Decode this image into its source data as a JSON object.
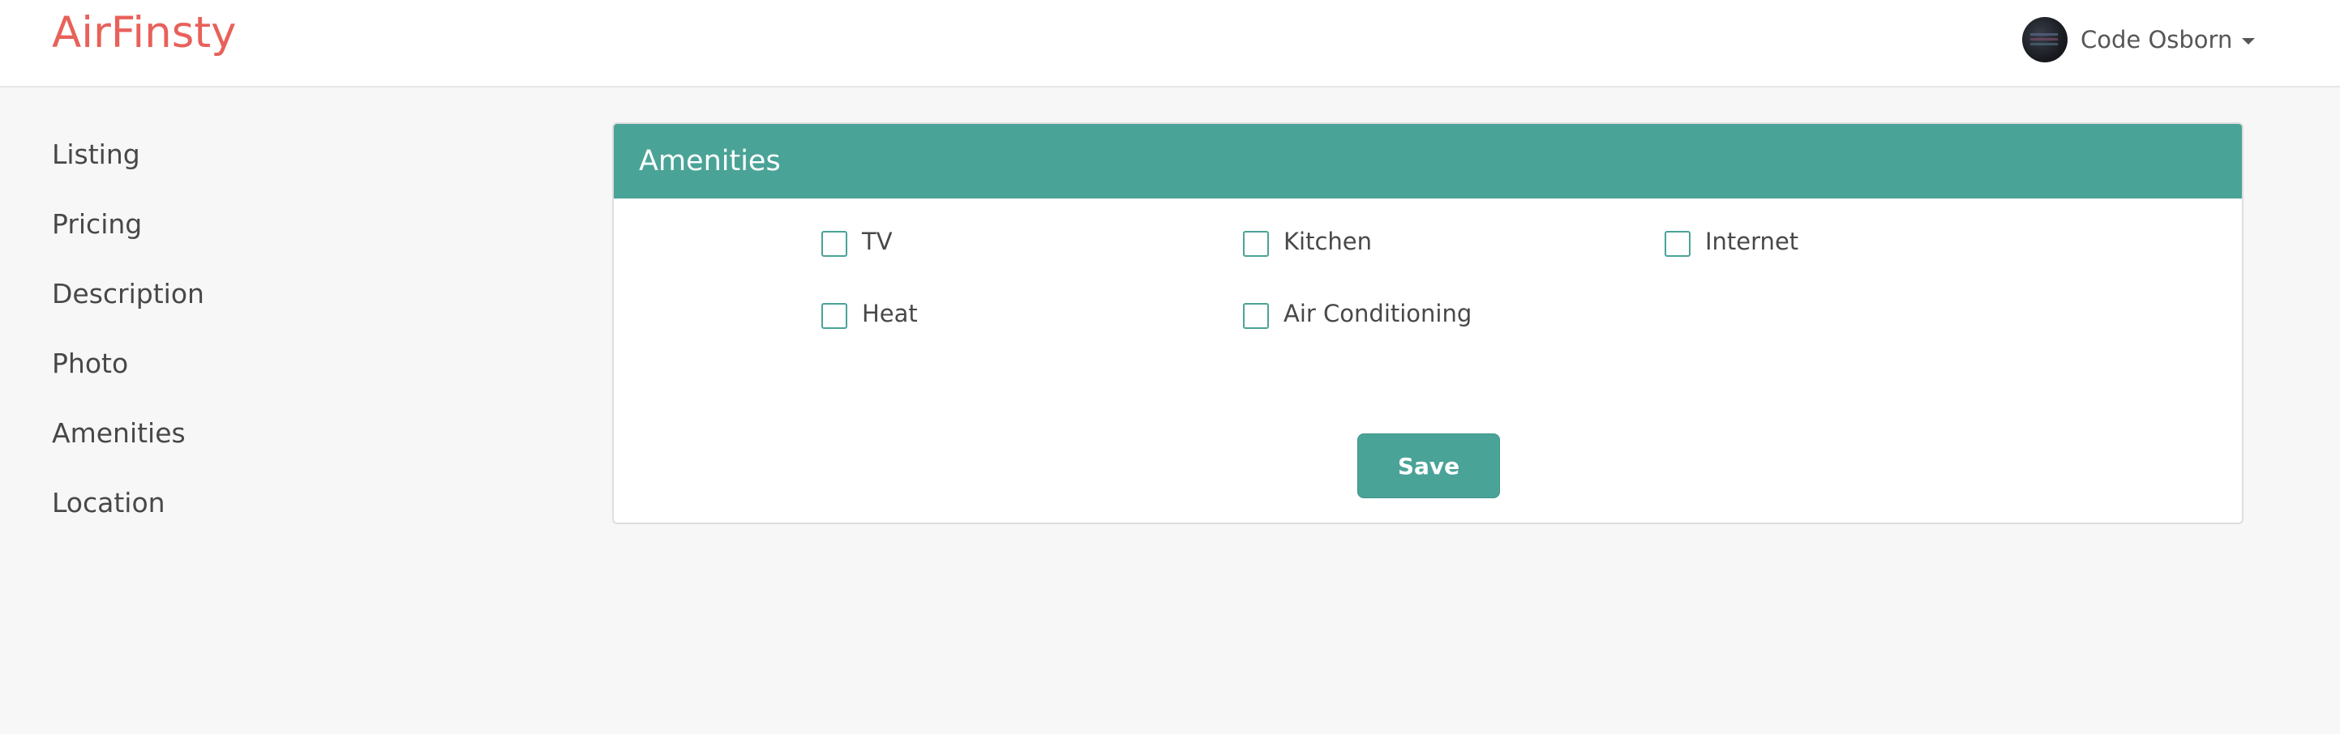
{
  "header": {
    "brand": "AirFinsty",
    "user_name": "Code Osborn"
  },
  "sidebar": {
    "items": [
      {
        "label": "Listing"
      },
      {
        "label": "Pricing"
      },
      {
        "label": "Description"
      },
      {
        "label": "Photo"
      },
      {
        "label": "Amenities"
      },
      {
        "label": "Location"
      }
    ]
  },
  "panel": {
    "title": "Amenities",
    "amenities": [
      {
        "label": "TV",
        "checked": false
      },
      {
        "label": "Kitchen",
        "checked": false
      },
      {
        "label": "Internet",
        "checked": false
      },
      {
        "label": "Heat",
        "checked": false
      },
      {
        "label": "Air Conditioning",
        "checked": false
      }
    ],
    "save_label": "Save"
  },
  "colors": {
    "brand": "#e8615a",
    "accent": "#4aa397",
    "background": "#f7f7f7"
  }
}
